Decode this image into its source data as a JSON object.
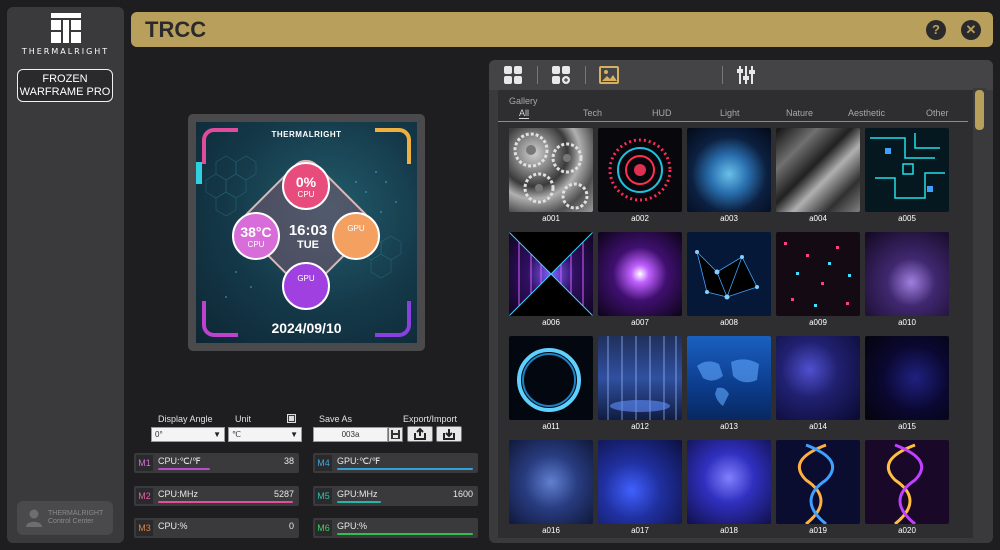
{
  "sidebar": {
    "logo_text": "THERMALRIGHT",
    "device_button": {
      "line1": "FROZEN",
      "line2": "WARFRAME PRO"
    },
    "control_center": {
      "line1": "THERMALRIGHT",
      "line2": "Control Center"
    }
  },
  "titlebar": {
    "title": "TRCC",
    "help_label": "?",
    "close_label": "✕"
  },
  "preview": {
    "brand": "THERMALRIGHT",
    "cpu_usage": {
      "value": "0%",
      "label": "CPU"
    },
    "cpu_temp": {
      "value": "38°C",
      "label": "CPU"
    },
    "gpu_temp": {
      "value": "",
      "label": "GPU"
    },
    "gpu_usage": {
      "value": "",
      "label": "GPU"
    },
    "time": "16:03",
    "day": "TUE",
    "date": "2024/09/10"
  },
  "controls": {
    "display_angle_label": "Display Angle",
    "display_angle_value": "0°",
    "unit_label": "Unit",
    "unit_value": "℃",
    "save_as_label": "Save As",
    "save_as_value": "003a",
    "export_import_label": "Export/Import"
  },
  "metrics": [
    {
      "tag": "M1",
      "name": "CPU:℃/℉",
      "value": "38",
      "tag_color": "#d070d0",
      "bar_color": "#b84cc8"
    },
    {
      "tag": "M2",
      "name": "CPU:MHz",
      "value": "5287",
      "tag_color": "#e060a8",
      "bar_color": "#e0509c"
    },
    {
      "tag": "M3",
      "name": "CPU:%",
      "value": "0",
      "tag_color": "#e08040",
      "bar_color": "#e08040"
    },
    {
      "tag": "M4",
      "name": "GPU:℃/℉",
      "value": "",
      "tag_color": "#40a8e0",
      "bar_color": "#2fa0d8"
    },
    {
      "tag": "M5",
      "name": "GPU:MHz",
      "value": "1600",
      "tag_color": "#30c0b0",
      "bar_color": "#22b8a8"
    },
    {
      "tag": "M6",
      "name": "GPU:%",
      "value": "",
      "tag_color": "#40d060",
      "bar_color": "#30c050"
    }
  ],
  "gallery": {
    "label": "Gallery",
    "categories": [
      "All",
      "Tech",
      "HUD",
      "Light",
      "Nature",
      "Aesthetic",
      "Other"
    ],
    "active_category": "All",
    "items": [
      "a001",
      "a002",
      "a003",
      "a004",
      "a005",
      "a006",
      "a007",
      "a008",
      "a009",
      "a010",
      "a011",
      "a012",
      "a013",
      "a014",
      "a015",
      "a016",
      "a017",
      "a018",
      "a019",
      "a020"
    ]
  },
  "colors": {
    "accent": "#b8a05c",
    "panel": "#3a3a3c",
    "background": "#1e1e20"
  }
}
